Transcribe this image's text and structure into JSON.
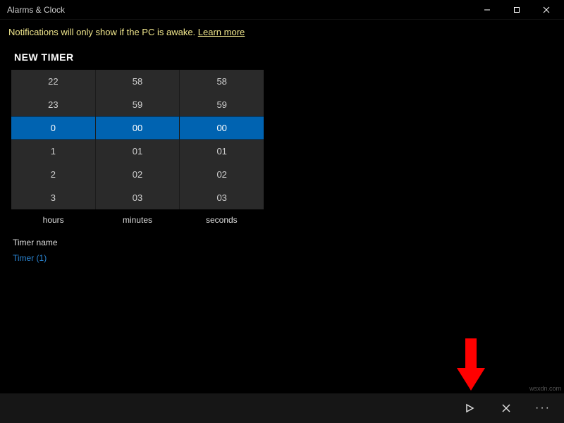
{
  "window": {
    "title": "Alarms & Clock"
  },
  "notification": {
    "text": "Notifications will only show if the PC is awake. ",
    "link_text": "Learn more"
  },
  "page": {
    "heading": "NEW TIMER"
  },
  "picker": {
    "hours": {
      "label": "hours",
      "values": [
        "22",
        "23",
        "0",
        "1",
        "2",
        "3"
      ],
      "selected_index": 2
    },
    "minutes": {
      "label": "minutes",
      "values": [
        "58",
        "59",
        "00",
        "01",
        "02",
        "03"
      ],
      "selected_index": 2
    },
    "seconds": {
      "label": "seconds",
      "values": [
        "58",
        "59",
        "00",
        "01",
        "02",
        "03"
      ],
      "selected_index": 2
    }
  },
  "timer_name": {
    "label": "Timer name",
    "value": "Timer (1)"
  },
  "commands": {
    "play": "Start",
    "cancel": "Cancel",
    "more": "More"
  },
  "watermark": "wsxdn.com"
}
